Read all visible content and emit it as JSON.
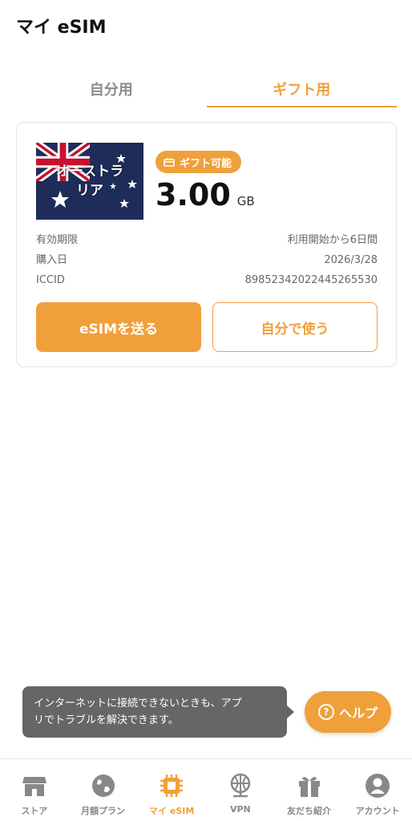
{
  "header": {
    "title": "マイ eSIM"
  },
  "tabs": [
    {
      "label": "自分用"
    },
    {
      "label": "ギフト用"
    }
  ],
  "card": {
    "country": "オーストラリア",
    "country_line1": "オーストラ",
    "country_line2": "リア",
    "badge": "ギフト可能",
    "data_amount": "3.00",
    "data_unit": "GB",
    "rows": [
      {
        "label": "有効期限",
        "value": "利用開始から6日間"
      },
      {
        "label": "購入日",
        "value": "2026/3/28"
      },
      {
        "label": "ICCID",
        "value": "89852342022445265530"
      }
    ],
    "send_button": "eSIMを送る",
    "use_button": "自分で使う"
  },
  "tooltip": {
    "line1": "インターネットに接続できないときも、アプ",
    "line2": "リでトラブルを解決できます。"
  },
  "help": {
    "label": "ヘルプ"
  },
  "nav": [
    {
      "label": "ストア",
      "icon": "store-icon"
    },
    {
      "label": "月額プラン",
      "icon": "globe-icon"
    },
    {
      "label": "マイ eSIM",
      "icon": "chip-icon"
    },
    {
      "label": "VPN",
      "icon": "network-icon"
    },
    {
      "label": "友だち紹介",
      "icon": "gift-icon"
    },
    {
      "label": "アカウント",
      "icon": "account-icon"
    }
  ],
  "colors": {
    "accent": "#f0a03a",
    "nav_inactive": "#888888",
    "tooltip_bg": "#666666"
  }
}
